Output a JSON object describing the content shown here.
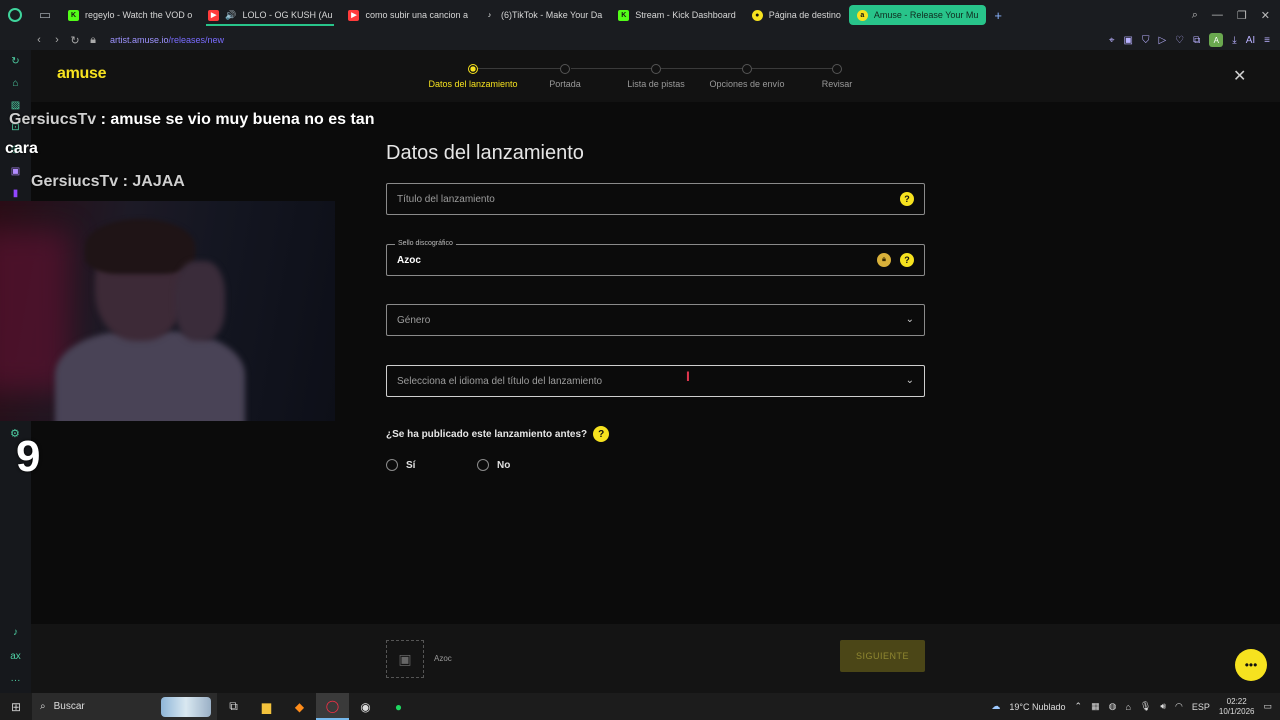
{
  "browser": {
    "tabs": [
      {
        "title": "regeylo - Watch the VOD o",
        "color": "#53fc18",
        "glyph": "K"
      },
      {
        "title": "LOLO - OG KUSH (Au",
        "color": "#ff3b3b",
        "glyph": "▶"
      },
      {
        "title": "como subir una cancion a",
        "color": "#ff3b3b",
        "glyph": "▶"
      },
      {
        "title": "(6)TikTok - Make Your Da",
        "color": "#e8e8e8",
        "glyph": "♪"
      },
      {
        "title": "Stream - Kick Dashboard",
        "color": "#53fc18",
        "glyph": "K"
      },
      {
        "title": "Página de destino",
        "color": "#f6e21f",
        "glyph": "●"
      },
      {
        "title": "Amuse - Release Your Mu",
        "color": "#f6e21f",
        "glyph": "a"
      }
    ],
    "url_host": "artist.amuse.io",
    "url_path": "/releases/new",
    "ext_ai_label": "AI",
    "profile_initial": "A"
  },
  "amuse": {
    "logo": "amuse",
    "steps": [
      "Datos del lanzamiento",
      "Portada",
      "Lista de pistas",
      "Opciones de envío",
      "Revisar"
    ],
    "page_title": "Datos del lanzamiento",
    "fields": {
      "title_placeholder": "Título del lanzamiento",
      "label_caption": "Sello discográfico",
      "label_value": "Azoc",
      "genre_placeholder": "Género",
      "language_placeholder": "Selecciona el idioma del título del lanzamiento"
    },
    "help_glyph": "?",
    "question": "¿Se ha publicado este lanzamiento antes?",
    "radio_yes": "Sí",
    "radio_no": "No",
    "footer_artist": "Azoc",
    "next_button": "SIGUIENTE"
  },
  "overlay": {
    "chat": [
      {
        "user": "GersiucsTv",
        "message": ": amuse se vio muy buena no es tan"
      },
      {
        "user": "",
        "message": "cara"
      },
      {
        "user": "GersiucsTv",
        "message": ": JAJAA"
      }
    ],
    "counter": "9"
  },
  "taskbar": {
    "search_label": "Buscar",
    "weather": "19°C  Nublado",
    "language": "ESP",
    "time": "02:22",
    "date": "10/1/2026"
  },
  "colors": {
    "brand_yellow": "#f6e21f",
    "active_tab": "#28c48a",
    "page_bg": "#0b0b0b"
  }
}
